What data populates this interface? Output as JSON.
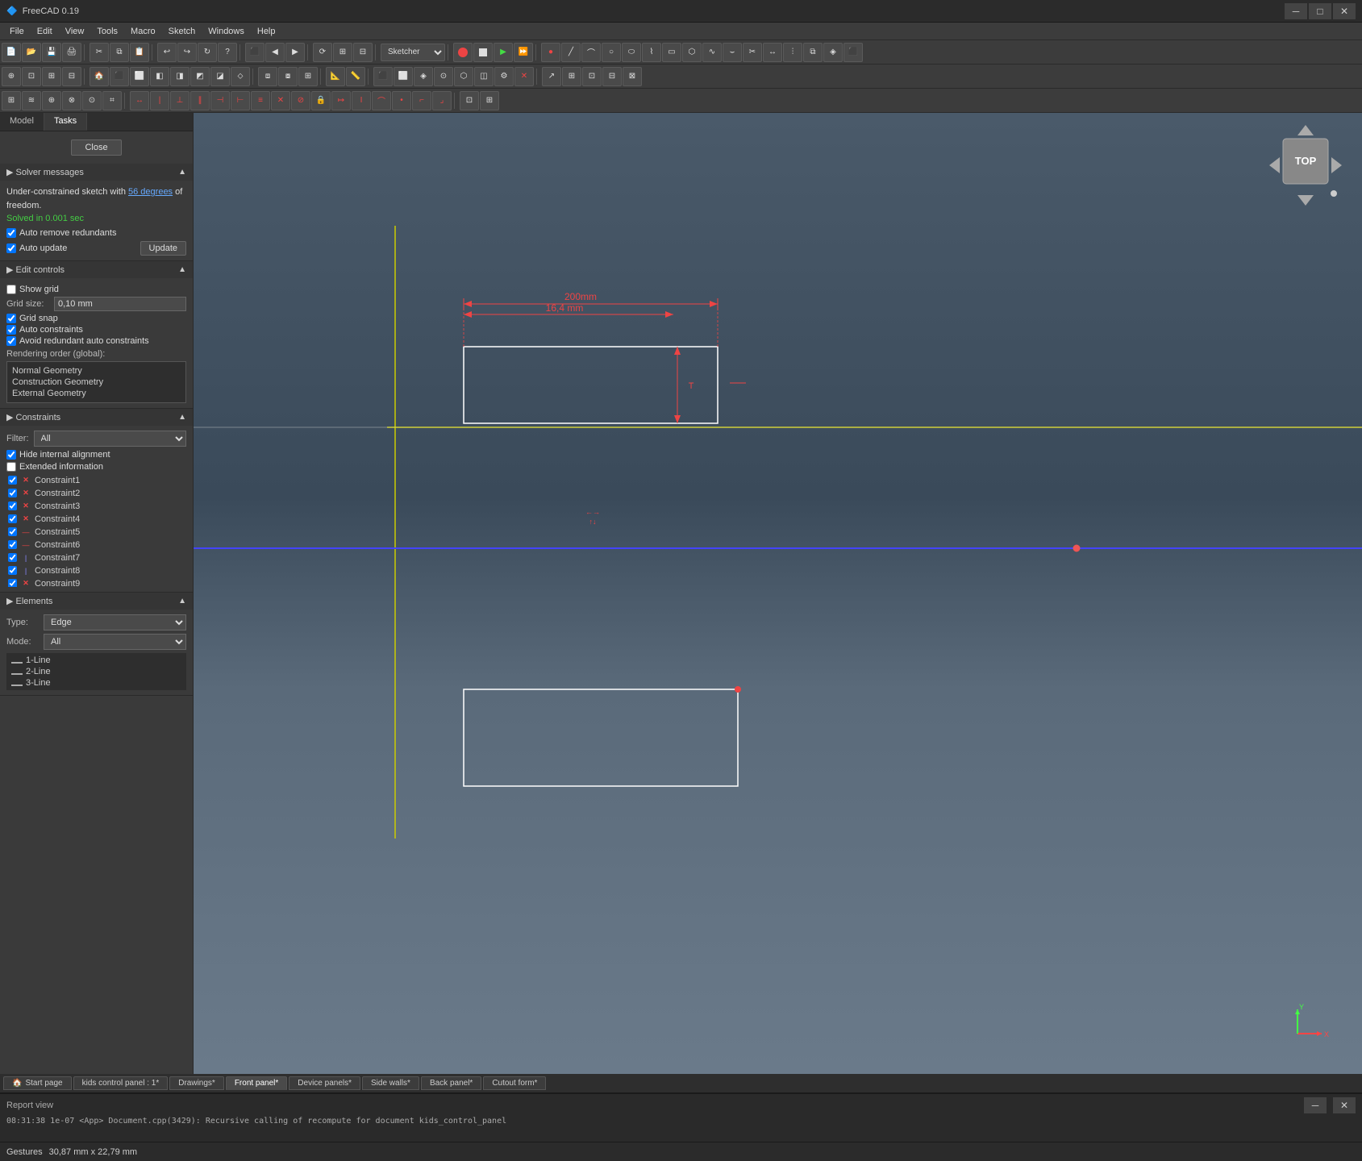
{
  "titlebar": {
    "title": "FreeCAD 0.19",
    "icon": "🔷",
    "controls": [
      "─",
      "□",
      "✕"
    ]
  },
  "menubar": {
    "items": [
      "File",
      "Edit",
      "View",
      "Tools",
      "Macro",
      "Sketch",
      "Windows",
      "Help"
    ]
  },
  "toolbar1": {
    "sketcher_dropdown": "Sketcher"
  },
  "panel": {
    "tabs": [
      "Model",
      "Tasks"
    ],
    "active_tab": "Tasks",
    "close_button": "Close"
  },
  "solver_messages": {
    "title": "Solver messages",
    "message": "Under-constrained sketch with ",
    "degrees_link": "56 degrees",
    "message2": " of freedom.",
    "solved_text": "Solved in 0.001 sec",
    "auto_remove": "Auto remove redundants",
    "auto_update": "Auto update",
    "update_button": "Update"
  },
  "edit_controls": {
    "title": "Edit controls",
    "show_grid": "Show grid",
    "grid_size_label": "Grid size:",
    "grid_size_value": "0,10 mm",
    "grid_snap": "Grid snap",
    "auto_constraints": "Auto constraints",
    "avoid_redundant": "Avoid redundant auto constraints",
    "rendering_order_label": "Rendering order (global):",
    "rendering_order": [
      "Normal Geometry",
      "Construction Geometry",
      "External Geometry"
    ]
  },
  "constraints": {
    "title": "Constraints",
    "filter_label": "Filter:",
    "filter_value": "All",
    "hide_internal": "Hide internal alignment",
    "extended_info": "Extended information",
    "items": [
      {
        "name": "Constraint1",
        "icon": "x",
        "checked": true
      },
      {
        "name": "Constraint2",
        "icon": "x",
        "checked": true
      },
      {
        "name": "Constraint3",
        "icon": "x",
        "checked": true
      },
      {
        "name": "Constraint4",
        "icon": "x",
        "checked": true
      },
      {
        "name": "Constraint5",
        "icon": "line",
        "checked": true
      },
      {
        "name": "Constraint6",
        "icon": "line",
        "checked": true
      },
      {
        "name": "Constraint7",
        "icon": "vline",
        "checked": true
      },
      {
        "name": "Constraint8",
        "icon": "vline",
        "checked": true
      },
      {
        "name": "Constraint9",
        "icon": "x",
        "checked": true
      }
    ]
  },
  "elements": {
    "title": "Elements",
    "type_label": "Type:",
    "type_value": "Edge",
    "mode_label": "Mode:",
    "mode_value": "All",
    "items": [
      {
        "name": "1-Line"
      },
      {
        "name": "2-Line"
      },
      {
        "name": "3-Line"
      }
    ]
  },
  "viewport": {
    "dimensions": "200mm x 16,4mm",
    "dim1": "200mm",
    "dim2": "16,4 mm",
    "coords": "30,87 mm x 22,79 mm",
    "gestures": "Gesture"
  },
  "navcube": {
    "label": "TOP",
    "arrows": [
      "▲",
      "◄",
      "►",
      "▼"
    ]
  },
  "tabbar": {
    "tabs": [
      {
        "label": "Start page",
        "active": false
      },
      {
        "label": "kids control panel : 1*",
        "active": false
      },
      {
        "label": "Drawings*",
        "active": false
      },
      {
        "label": "Front panel*",
        "active": false
      },
      {
        "label": "Device panels*",
        "active": false
      },
      {
        "label": "Side walls*",
        "active": false
      },
      {
        "label": "Back panel*",
        "active": false
      },
      {
        "label": "Cutout form*",
        "active": false
      }
    ]
  },
  "report": {
    "title": "Report view",
    "content": "08:31:38  1e-07 <App> Document.cpp(3429): Recursive calling of recompute for document kids_control_panel"
  },
  "statusbar": {
    "gestures": "Gestures",
    "coords": "30,87 mm x 22,79 mm"
  }
}
